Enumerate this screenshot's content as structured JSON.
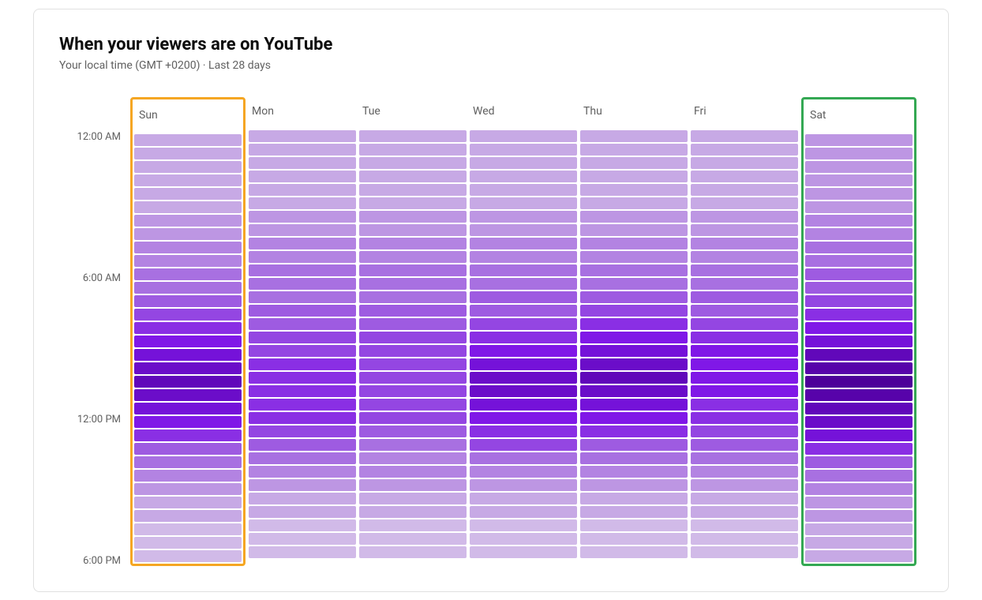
{
  "header": {
    "title": "When your viewers are on YouTube",
    "subtitle": "Your local time (GMT +0200) · Last 28 days"
  },
  "yLabels": [
    "12:00 AM",
    "6:00 AM",
    "12:00 PM",
    "6:00 PM"
  ],
  "days": [
    {
      "id": "sun",
      "label": "Sun",
      "highlight": "orange"
    },
    {
      "id": "mon",
      "label": "Mon",
      "highlight": null
    },
    {
      "id": "tue",
      "label": "Tue",
      "highlight": null
    },
    {
      "id": "wed",
      "label": "Wed",
      "highlight": null
    },
    {
      "id": "thu",
      "label": "Thu",
      "highlight": null
    },
    {
      "id": "fri",
      "label": "Fri",
      "highlight": null
    },
    {
      "id": "sat",
      "label": "Sat",
      "highlight": "green"
    }
  ],
  "colors": {
    "orange": "#f5a623",
    "green": "#34a853",
    "purple_levels": [
      "#c9b3e8",
      "#c4ade6",
      "#bda5e2",
      "#b89dde",
      "#b095d9",
      "#a88cd4",
      "#a183cf",
      "#9b7bca",
      "#9472c5",
      "#8f6bc0",
      "#8862ba",
      "#825ab5",
      "#7c52b0",
      "#7849aa",
      "#7240a5",
      "#6c389f",
      "#660f9a",
      "#600095",
      "#5c008f",
      "#580089",
      "#540084",
      "#500080",
      "#4c007b",
      "#8040b0"
    ]
  },
  "heatmap": {
    "sun": [
      2,
      2,
      2,
      2,
      2,
      2,
      3,
      3,
      4,
      4,
      5,
      5,
      6,
      7,
      8,
      9,
      10,
      11,
      12,
      11,
      10,
      9,
      8,
      6,
      5,
      4,
      3,
      2,
      2,
      1,
      1,
      1
    ],
    "mon": [
      2,
      2,
      2,
      2,
      2,
      2,
      3,
      3,
      4,
      4,
      5,
      5,
      5,
      6,
      6,
      7,
      7,
      8,
      8,
      8,
      8,
      8,
      7,
      6,
      5,
      4,
      3,
      2,
      2,
      1,
      1,
      1
    ],
    "tue": [
      2,
      2,
      2,
      2,
      2,
      2,
      3,
      3,
      4,
      4,
      5,
      5,
      5,
      6,
      6,
      7,
      7,
      7,
      7,
      7,
      7,
      7,
      6,
      5,
      4,
      4,
      3,
      2,
      2,
      1,
      1,
      1
    ],
    "wed": [
      2,
      2,
      2,
      2,
      2,
      2,
      3,
      3,
      4,
      4,
      5,
      5,
      6,
      6,
      7,
      8,
      9,
      10,
      11,
      11,
      10,
      9,
      8,
      7,
      5,
      4,
      3,
      2,
      2,
      1,
      1,
      1
    ],
    "thu": [
      2,
      2,
      2,
      2,
      2,
      2,
      3,
      3,
      4,
      4,
      5,
      5,
      6,
      7,
      8,
      9,
      10,
      11,
      12,
      11,
      10,
      9,
      8,
      6,
      5,
      4,
      3,
      2,
      2,
      1,
      1,
      1
    ],
    "fri": [
      2,
      2,
      2,
      2,
      2,
      2,
      3,
      3,
      4,
      4,
      5,
      5,
      6,
      6,
      7,
      8,
      9,
      9,
      9,
      9,
      8,
      8,
      7,
      6,
      5,
      4,
      3,
      2,
      2,
      1,
      1,
      1
    ],
    "sat": [
      3,
      3,
      3,
      3,
      3,
      3,
      4,
      4,
      5,
      5,
      6,
      6,
      7,
      8,
      9,
      10,
      12,
      13,
      14,
      13,
      12,
      11,
      10,
      8,
      6,
      5,
      4,
      3,
      3,
      2,
      2,
      2
    ]
  }
}
